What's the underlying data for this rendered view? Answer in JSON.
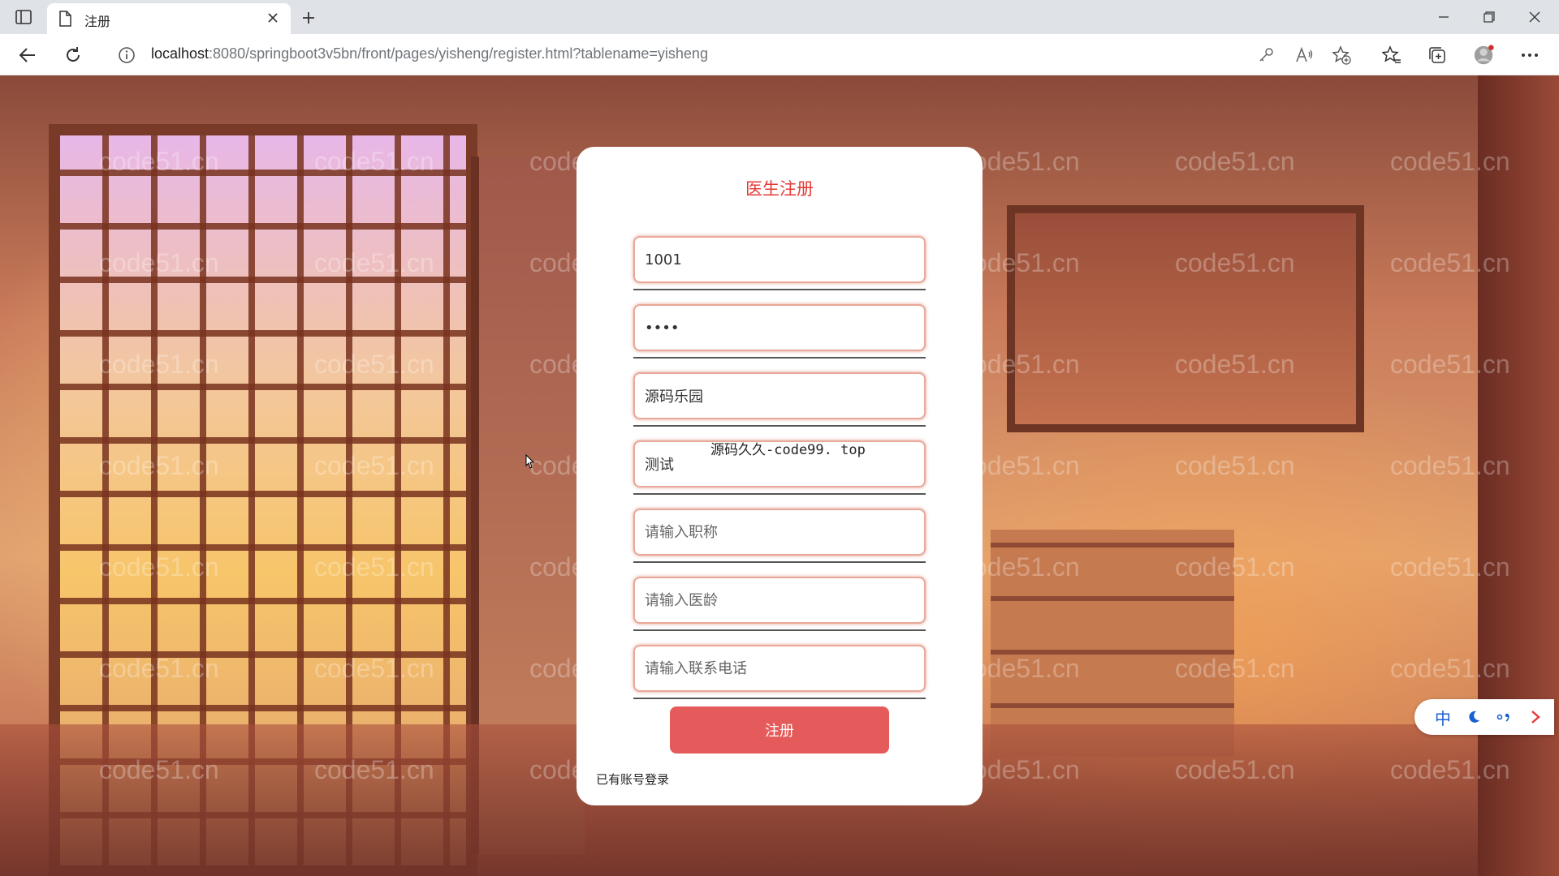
{
  "browser": {
    "tab_title": "注册",
    "url_host": "localhost",
    "url_rest": ":8080/springboot3v5bn/front/pages/yisheng/register.html?tablename=yisheng"
  },
  "watermark_text": "code51.cn",
  "form": {
    "title": "医生注册",
    "fields": [
      {
        "value": "1001",
        "placeholder": "",
        "type": "text"
      },
      {
        "value": "••••",
        "placeholder": "",
        "type": "text"
      },
      {
        "value": "源码乐园",
        "placeholder": "",
        "type": "text"
      },
      {
        "value": "测试",
        "placeholder": "",
        "type": "text"
      },
      {
        "value": "",
        "placeholder": "请输入职称",
        "type": "text"
      },
      {
        "value": "",
        "placeholder": "请输入医龄",
        "type": "text"
      },
      {
        "value": "",
        "placeholder": "请输入联系电话",
        "type": "text"
      }
    ],
    "overlay_text": "源码久久-code99. top",
    "submit_label": "注册",
    "login_link": "已有账号登录"
  },
  "ime": {
    "lang_label": "中"
  },
  "colors": {
    "accent": "#e55b5b",
    "title_red": "#e53935",
    "field_border": "#e8a89a"
  }
}
